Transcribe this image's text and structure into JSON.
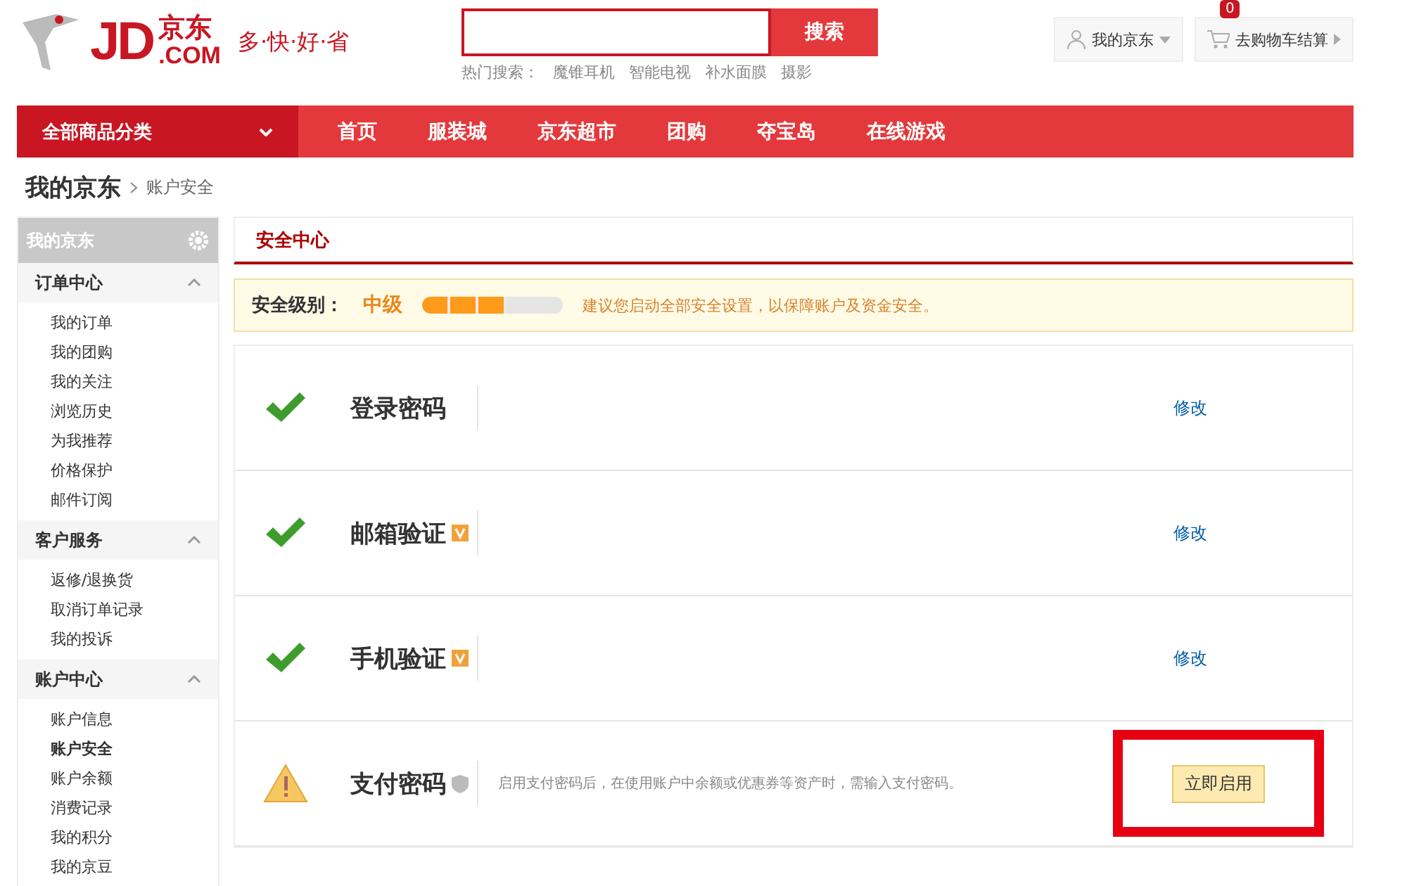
{
  "header": {
    "logo": {
      "mark": "JD",
      "brand": "京东",
      "domain": ".COM"
    },
    "slogan": "多·快·好·省",
    "search": {
      "button": "搜索",
      "hot_label": "热门搜索：",
      "hot": [
        "魔锥耳机",
        "智能电视",
        "补水面膜",
        "摄影"
      ]
    },
    "my_jd": "我的京东",
    "cart": {
      "label": "去购物车结算",
      "count": "0"
    }
  },
  "nav": {
    "category": "全部商品分类",
    "items": [
      "首页",
      "服装城",
      "京东超市",
      "团购",
      "夺宝岛",
      "在线游戏"
    ]
  },
  "breadcrumb": {
    "title": "我的京东",
    "current": "账户安全"
  },
  "sidebar": {
    "title": "我的京东",
    "sections": [
      {
        "label": "订单中心",
        "expanded": true,
        "items": [
          {
            "label": "我的订单",
            "selected": false
          },
          {
            "label": "我的团购",
            "selected": false
          },
          {
            "label": "我的关注",
            "selected": false
          },
          {
            "label": "浏览历史",
            "selected": false
          },
          {
            "label": "为我推荐",
            "selected": false
          },
          {
            "label": "价格保护",
            "selected": false
          },
          {
            "label": "邮件订阅",
            "selected": false
          }
        ]
      },
      {
        "label": "客户服务",
        "expanded": true,
        "items": [
          {
            "label": "返修/退换货",
            "selected": false
          },
          {
            "label": "取消订单记录",
            "selected": false
          },
          {
            "label": "我的投诉",
            "selected": false
          }
        ]
      },
      {
        "label": "账户中心",
        "expanded": true,
        "items": [
          {
            "label": "账户信息",
            "selected": false
          },
          {
            "label": "账户安全",
            "selected": true
          },
          {
            "label": "账户余额",
            "selected": false
          },
          {
            "label": "消费记录",
            "selected": false
          },
          {
            "label": "我的积分",
            "selected": false
          },
          {
            "label": "我的京豆",
            "selected": false
          }
        ]
      }
    ]
  },
  "main": {
    "title": "安全中心",
    "level_bar": {
      "label": "安全级别：",
      "grade": "中级",
      "level": 0.6,
      "tip": "建议您启动全部安全设置，以保障账户及资金安全。"
    },
    "rows": [
      {
        "kind": "ok",
        "name": "登录密码",
        "action": {
          "kind": "link",
          "label": "修改"
        },
        "highlighted": false
      },
      {
        "kind": "ok",
        "name": "邮箱验证",
        "badge": {
          "kind": "verified"
        },
        "action": {
          "kind": "link",
          "label": "修改"
        },
        "highlighted": false
      },
      {
        "kind": "ok",
        "name": "手机验证",
        "badge": {
          "kind": "verified"
        },
        "action": {
          "kind": "link",
          "label": "修改"
        },
        "highlighted": false
      },
      {
        "kind": "warn",
        "name": "支付密码",
        "badge": {
          "kind": "shield"
        },
        "description": "启用支付密码后，在使用账户中余额或优惠券等资产时，需输入支付密码。",
        "action": {
          "kind": "button",
          "label": "立即启用"
        },
        "highlighted": true
      }
    ]
  }
}
